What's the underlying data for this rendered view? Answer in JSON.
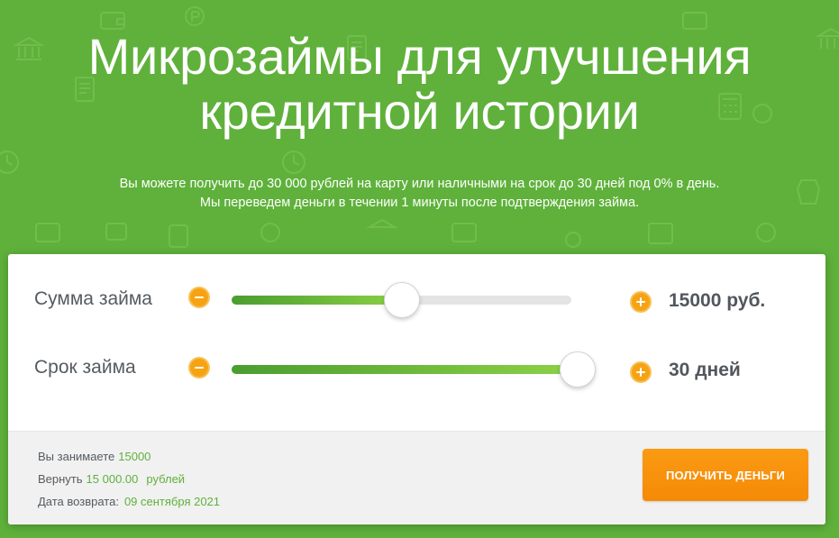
{
  "hero": {
    "title_line1": "Микрозаймы для улучшения",
    "title_line2": "кредитной истории",
    "subtitle_line1": "Вы можете получить до 30 000 рублей на карту или наличными на срок до 30 дней под 0% в день.",
    "subtitle_line2": "Мы переведем деньги в течении 1 минуты после подтверждения займа."
  },
  "calculator": {
    "amount": {
      "label": "Сумма займа",
      "value": "15000 руб.",
      "slider_fraction": 0.5
    },
    "term": {
      "label": "Срок займа",
      "value": "30 дней",
      "slider_fraction": 1.0
    }
  },
  "summary": {
    "borrow_label": "Вы занимаете",
    "borrow_value": "15000",
    "return_label": "Вернуть",
    "return_value": "15 000.00",
    "return_currency": "рублей",
    "date_label": "Дата возврата:",
    "date_value": "09 сентября 2021",
    "cta_label": "ПОЛУЧИТЬ ДЕНЬГИ"
  },
  "colors": {
    "background": "#5fb13b",
    "accent_orange": "#f6a313",
    "accent_green": "#5fb13b"
  },
  "icons": [
    "bank-icon",
    "wallet-icon",
    "ruble-coin-icon",
    "calculator-icon",
    "clock-icon",
    "document-icon"
  ]
}
